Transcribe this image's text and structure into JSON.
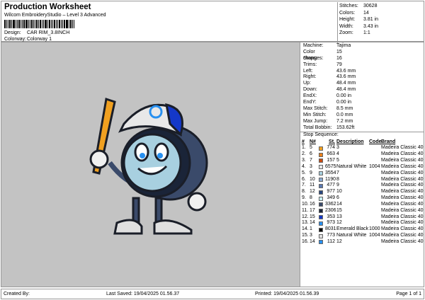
{
  "header": {
    "title": "Production Worksheet",
    "subtitle": "Wilcom EmbroideryStudio – Level 3 Advanced",
    "design_label": "Design:",
    "design": "CAR RIM_3.8INCH",
    "colorway_label": "Colorway:",
    "colorway": "Colorway 1"
  },
  "stats": [
    {
      "label": "Stitches:",
      "value": "30628"
    },
    {
      "label": "Colors:",
      "value": "14"
    },
    {
      "label": "Height:",
      "value": "3.81 in"
    },
    {
      "label": "Width:",
      "value": "3.43 in"
    },
    {
      "label": "Zoom:",
      "value": "1:1"
    }
  ],
  "props": [
    {
      "label": "Machine:",
      "value": "Tajima"
    },
    {
      "label": "Color changes:",
      "value": "15"
    },
    {
      "label": "Stops:",
      "value": "16"
    },
    {
      "label": "Trims:",
      "value": "79"
    },
    {
      "label": "Left:",
      "value": "43.6 mm"
    },
    {
      "label": "Right:",
      "value": "43.6 mm"
    },
    {
      "label": "Up:",
      "value": "48.4 mm"
    },
    {
      "label": "Down:",
      "value": "48.4 mm"
    },
    {
      "label": "EndX:",
      "value": "0.00 in"
    },
    {
      "label": "EndY:",
      "value": "0.00 in"
    },
    {
      "label": "Max Stitch:",
      "value": "8.5 mm"
    },
    {
      "label": "Min Stitch:",
      "value": "0.0 mm"
    },
    {
      "label": "Max Jump:",
      "value": "7.2 mm"
    },
    {
      "label": "Total Bobbin:",
      "value": "153.62ft"
    }
  ],
  "stop_sequence": {
    "title": "Stop Sequence:",
    "headers": [
      "#",
      "N#",
      "St.",
      "Description",
      "Code",
      "Brand"
    ],
    "rows": [
      {
        "n": "1.",
        "num": "5",
        "color": "#f0a020",
        "st": "774",
        "desc": "3",
        "code": "",
        "brand": "Madeira Classic 40"
      },
      {
        "n": "2.",
        "num": "6",
        "color": "#e8801c",
        "st": "663",
        "desc": "4",
        "code": "",
        "brand": "Madeira Classic 40"
      },
      {
        "n": "3.",
        "num": "7",
        "color": "#c84a10",
        "st": "157",
        "desc": "5",
        "code": "",
        "brand": "Madeira Classic 40"
      },
      {
        "n": "4.",
        "num": "3",
        "color": "#e8e8e8",
        "st": "6575",
        "desc": "Natural White",
        "code": "1004",
        "brand": "Madeira Classic 40"
      },
      {
        "n": "5.",
        "num": "9",
        "color": "#a8d0e0",
        "st": "3554",
        "desc": "7",
        "code": "",
        "brand": "Madeira Classic 40"
      },
      {
        "n": "6.",
        "num": "10",
        "color": "#8aa8d0",
        "st": "1190",
        "desc": "8",
        "code": "",
        "brand": "Madeira Classic 40"
      },
      {
        "n": "7.",
        "num": "11",
        "color": "#5a78b0",
        "st": "477",
        "desc": "9",
        "code": "",
        "brand": "Madeira Classic 40"
      },
      {
        "n": "8.",
        "num": "12",
        "color": "#2a4880",
        "st": "977",
        "desc": "10",
        "code": "",
        "brand": "Madeira Classic 40"
      },
      {
        "n": "9.",
        "num": "8",
        "color": "#c8f0f4",
        "st": "349",
        "desc": "6",
        "code": "",
        "brand": "Madeira Classic 40"
      },
      {
        "n": "10.",
        "num": "16",
        "color": "#3a4a6a",
        "st": "3362",
        "desc": "14",
        "code": "",
        "brand": "Madeira Classic 40"
      },
      {
        "n": "11.",
        "num": "17",
        "color": "#1a2438",
        "st": "2306",
        "desc": "15",
        "code": "",
        "brand": "Madeira Classic 40"
      },
      {
        "n": "12.",
        "num": "15",
        "color": "#1438c8",
        "st": "353",
        "desc": "13",
        "code": "",
        "brand": "Madeira Classic 40"
      },
      {
        "n": "13.",
        "num": "14",
        "color": "#2890f0",
        "st": "973",
        "desc": "12",
        "code": "",
        "brand": "Madeira Classic 40"
      },
      {
        "n": "14.",
        "num": "1",
        "color": "#080808",
        "st": "8031",
        "desc": "Emerald Black",
        "code": "1000",
        "brand": "Madeira Classic 40"
      },
      {
        "n": "15.",
        "num": "3",
        "color": "#e0e0e0",
        "st": "773",
        "desc": "Natural White",
        "code": "1004",
        "brand": "Madeira Classic 40"
      },
      {
        "n": "16.",
        "num": "14",
        "color": "#2890f0",
        "st": "112",
        "desc": "12",
        "code": "",
        "brand": "Madeira Classic 40"
      }
    ]
  },
  "footer": {
    "created": "Created By:",
    "saved": "Last Saved: 19/04/2025 01.56.37",
    "printed": "Printed: 19/04/2025 01.56.39",
    "page": "Page 1 of 1"
  }
}
